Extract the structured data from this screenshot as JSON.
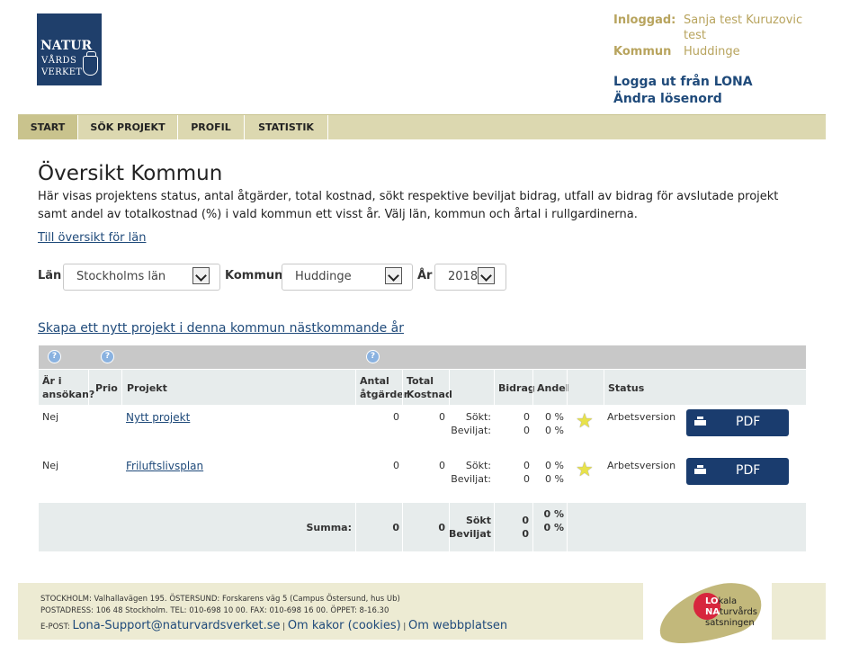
{
  "logo": {
    "line1": "NATUR",
    "line2": "VÅRDS",
    "line3": "VERKET"
  },
  "user": {
    "logged_in_label": "Inloggad:",
    "logged_in_value_1": "Sanja test Kuruzovic",
    "logged_in_value_2": "test",
    "municipality_label": "Kommun",
    "municipality_value": "Huddinge",
    "logout_link": "Logga ut från LONA",
    "change_password_link": "Ändra lösenord"
  },
  "nav": {
    "tabs": [
      {
        "label": "START",
        "active": true
      },
      {
        "label": "SÖK PROJEKT",
        "active": false
      },
      {
        "label": "PROFIL",
        "active": false
      },
      {
        "label": "STATISTIK",
        "active": false
      }
    ]
  },
  "page": {
    "title": "Översikt Kommun",
    "intro_line1": "Här visas projektens status, antal åtgärder, total kostnad, sökt respektive beviljat bidrag, utfall av bidrag för avslutade projekt",
    "intro_line2": "samt andel av totalkostnad (%) i vald kommun ett visst år. Välj län, kommun och årtal i rullgardinerna.",
    "county_overview_link": "Till översikt för län",
    "create_project_link": "Skapa ett nytt projekt i denna kommun nästkommande år"
  },
  "filters": {
    "county_label": "Län",
    "county_value": "Stockholms län",
    "municipality_label": "Kommun",
    "municipality_value": "Huddinge",
    "year_label": "År",
    "year_value": "2018"
  },
  "table": {
    "help_icon_symbol": "?",
    "headers": {
      "in_application_1": "Är i",
      "in_application_2": "ansökan?",
      "prio": "Prio",
      "project": "Projekt",
      "measures_1": "Antal",
      "measures_2": "åtgärder",
      "total_cost_1": "Total",
      "total_cost_2": "Kostnad",
      "grant": "Bidrag",
      "share": "Andel",
      "status": "Status"
    },
    "rows": [
      {
        "in_application": "Nej",
        "project": "Nytt projekt",
        "measures": "0",
        "total_cost": "0",
        "sought_label": "Sökt:",
        "granted_label": "Beviljat:",
        "sought_grant": "0",
        "granted_grant": "0",
        "sought_share": "0 %",
        "granted_share": "0 %",
        "status": "Arbetsversion",
        "pdf_label": "PDF"
      },
      {
        "in_application": "Nej",
        "project": "Friluftslivsplan",
        "measures": "0",
        "total_cost": "0",
        "sought_label": "Sökt:",
        "granted_label": "Beviljat:",
        "sought_grant": "0",
        "granted_grant": "0",
        "sought_share": "0 %",
        "granted_share": "0 %",
        "status": "Arbetsversion",
        "pdf_label": "PDF"
      }
    ],
    "summary": {
      "label": "Summa:",
      "measures": "0",
      "total_cost": "0",
      "sought_label": "Sökt",
      "granted_label": "Beviljat",
      "sought_grant": "0",
      "granted_grant": "0",
      "sought_share": "0 %",
      "granted_share": "0 %"
    }
  },
  "footer": {
    "address_line1": "STOCKHOLM: Valhallavägen 195. ÖSTERSUND: Forskarens väg 5 (Campus Östersund, hus Ub)",
    "address_line2": "POSTADRESS: 106 48 Stockholm. TEL: 010-698 10 00. FAX: 010-698 16 00. ÖPPET: 8-16.30",
    "email_label": "E-POST:",
    "email_link": "Lona-Support@naturvardsverket.se",
    "separator": "|",
    "cookies_link": "Om kakor (cookies)",
    "website_link": "Om webbplatsen"
  },
  "lona_logo": {
    "lo": "LO",
    "rest1": "kala",
    "na": "NA",
    "rest2": "turvårds",
    "line3": "satsningen"
  },
  "colors": {
    "nav_bg": "#dcd8b0",
    "nav_active": "#c9c38d",
    "link": "#1f4a7a",
    "pdf_button": "#1a3c6e",
    "table_header": "#e7ecec",
    "brand": "#1f3f6b"
  }
}
